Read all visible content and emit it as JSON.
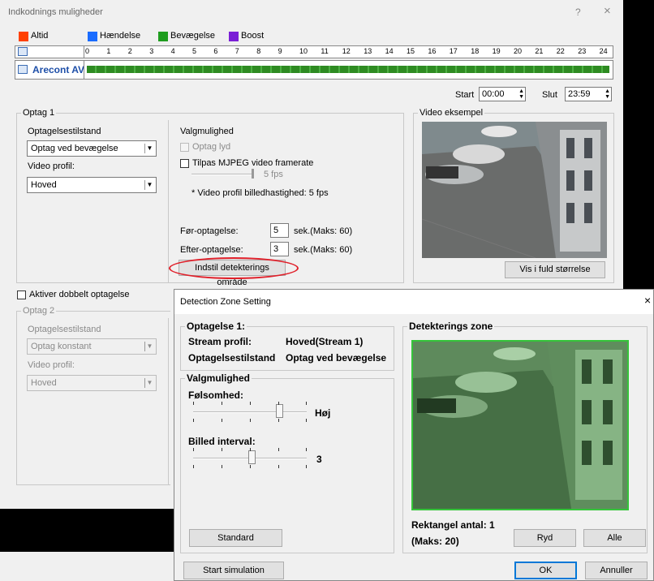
{
  "window": {
    "title": "Indkodnings muligheder",
    "help": "?",
    "close": "×"
  },
  "legend": [
    {
      "label": "Altid",
      "color": "#ff4000"
    },
    {
      "label": "Hændelse",
      "color": "#1a6cff"
    },
    {
      "label": "Bevægelse",
      "color": "#1f9d1f"
    },
    {
      "label": "Boost",
      "color": "#7a1fd6"
    }
  ],
  "timeline": {
    "hours": [
      "0",
      "1",
      "2",
      "3",
      "4",
      "5",
      "6",
      "7",
      "8",
      "9",
      "10",
      "11",
      "12",
      "13",
      "14",
      "15",
      "16",
      "17",
      "18",
      "19",
      "20",
      "21",
      "22",
      "23",
      "24"
    ]
  },
  "camera": {
    "name": "Arecont AV"
  },
  "time": {
    "start_label": "Start",
    "start_value": "00:00",
    "end_label": "Slut",
    "end_value": "23:59"
  },
  "optag1": {
    "title": "Optag 1",
    "mode_label": "Optagelsestilstand",
    "mode_value": "Optag ved bevægelse",
    "profile_label": "Video profil:",
    "profile_value": "Hoved"
  },
  "valg": {
    "title": "Valgmulighed",
    "audio": "Optag lyd",
    "mjpeg": "Tilpas MJPEG video framerate",
    "fps": "5 fps",
    "note": "* Video profil billedhastighed: 5 fps",
    "pre_label": "Før-optagelse:",
    "pre_value": "5",
    "pre_unit": "sek.(Maks: 60)",
    "post_label": "Efter-optagelse:",
    "post_value": "3",
    "post_unit": "sek.(Maks: 60)",
    "zone_button": "Indstil detekterings område"
  },
  "video": {
    "title": "Video eksempel",
    "fullsize": "Vis i fuld størrelse"
  },
  "dual": {
    "label": "Aktiver dobbelt optagelse"
  },
  "optag2": {
    "title": "Optag 2",
    "mode_label": "Optagelsestilstand",
    "mode_value": "Optag konstant",
    "profile_label": "Video profil:",
    "profile_value": "Hoved"
  },
  "dialog": {
    "title": "Detection Zone Setting",
    "close": "×",
    "opt_title": "Optagelse 1:",
    "stream_label": "Stream profil:",
    "stream_value": "Hoved(Stream 1)",
    "mode_label": "Optagelsestilstand",
    "mode_value": "Optag ved bevægelse",
    "valg_title": "Valgmulighed",
    "sens_label": "Følsomhed:",
    "sens_value": "Høj",
    "interval_label": "Billed interval:",
    "interval_value": "3",
    "standard": "Standard",
    "zone_title": "Detekterings zone",
    "rect_count": "Rektangel antal: 1",
    "rect_max": "(Maks: 20)",
    "clear": "Ryd",
    "all": "Alle",
    "simulate": "Start simulation",
    "ok": "OK",
    "cancel": "Annuller"
  }
}
